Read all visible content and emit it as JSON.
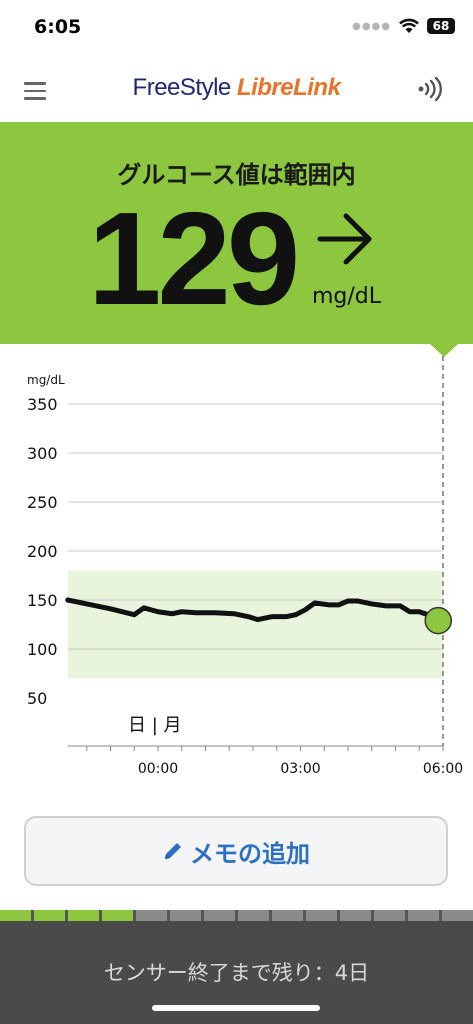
{
  "status_bar": {
    "time": "6:05",
    "battery": "68"
  },
  "header": {
    "logo_part1": "FreeStyle ",
    "logo_part2": "LibreLink"
  },
  "reading": {
    "status": "グルコース値は範囲内",
    "value": "129",
    "unit": "mg/dL",
    "trend": "steady-right-arrow"
  },
  "memo_button": {
    "label": "メモの追加",
    "icon": "pencil-icon"
  },
  "sensor": {
    "remaining_text": "センサー終了まで残り：4日",
    "segments_total": 14,
    "segments_filled": 4
  },
  "colors": {
    "accent_green": "#8dc63f",
    "target_range": "#e9f4dc",
    "link_blue": "#2d6fc4",
    "footer_gray": "#4a4a4a"
  },
  "chart_data": {
    "type": "line",
    "ylabel": "mg/dL",
    "yticks": [
      350,
      300,
      250,
      200,
      150,
      100,
      50
    ],
    "ylim": [
      30,
      365
    ],
    "xticks": [
      "00:00",
      "03:00",
      "06:00"
    ],
    "day_label": "日 | 月",
    "target_range": [
      70,
      180
    ],
    "x_hours": [
      -1.9,
      -1.5,
      -1.0,
      -0.5,
      -0.3,
      0.0,
      0.3,
      0.5,
      0.8,
      1.2,
      1.6,
      1.9,
      2.1,
      2.4,
      2.7,
      2.9,
      3.1,
      3.3,
      3.6,
      3.8,
      4.0,
      4.2,
      4.5,
      4.8,
      5.1,
      5.3,
      5.5,
      5.8
    ],
    "series": [
      {
        "values": [
          150,
          146,
          141,
          135,
          142,
          138,
          136,
          138,
          137,
          137,
          136,
          133,
          130,
          133,
          133,
          135,
          140,
          147,
          145,
          145,
          149,
          149,
          146,
          144,
          144,
          138,
          138,
          133
        ]
      }
    ],
    "current_value": 129,
    "current_x": 5.9
  }
}
